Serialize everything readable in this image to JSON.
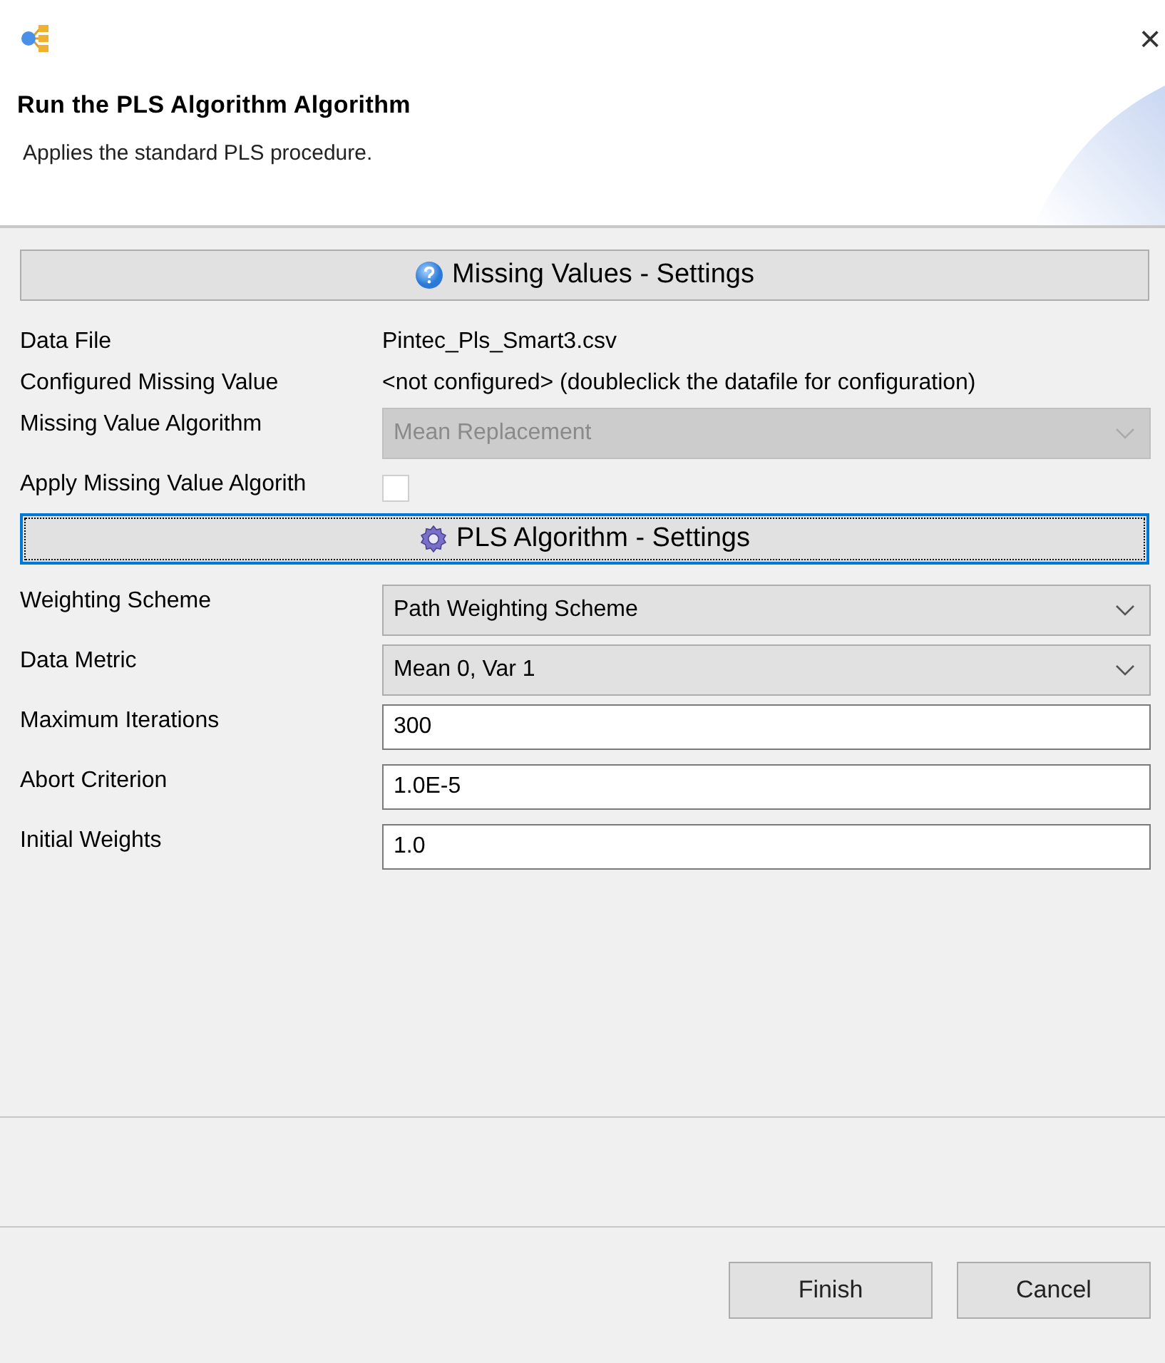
{
  "window": {
    "close": "×"
  },
  "header": {
    "title": "Run the PLS Algorithm Algorithm",
    "description": "Applies the standard PLS procedure."
  },
  "sections": [
    {
      "title": "Missing Values - Settings",
      "kind": "help",
      "focused": false,
      "rows": [
        {
          "kind": "text",
          "label": "Data File",
          "value": "Pintec_Pls_Smart3.csv"
        },
        {
          "kind": "text",
          "label": "Configured Missing Value",
          "value": "<not configured> (doubleclick the datafile for configuration)"
        },
        {
          "kind": "select",
          "label": "Missing Value Algorithm",
          "value": "Mean Replacement",
          "disabled": true
        },
        {
          "kind": "checkbox",
          "label": "Apply Missing Value Algorith",
          "checked": false
        }
      ]
    },
    {
      "title": "PLS Algorithm - Settings",
      "kind": "gear",
      "focused": true,
      "rows": [
        {
          "kind": "select",
          "label": "Weighting Scheme",
          "value": "Path Weighting Scheme",
          "disabled": false
        },
        {
          "kind": "select",
          "label": "Data Metric",
          "value": "Mean 0, Var 1",
          "disabled": false
        },
        {
          "kind": "input",
          "label": "Maximum Iterations",
          "value": "300"
        },
        {
          "kind": "input",
          "label": "Abort Criterion",
          "value": "1.0E-5"
        },
        {
          "kind": "input",
          "label": "Initial Weights",
          "value": "1.0"
        }
      ]
    }
  ],
  "buttons": [
    {
      "label": "Finish"
    },
    {
      "label": "Cancel"
    }
  ]
}
